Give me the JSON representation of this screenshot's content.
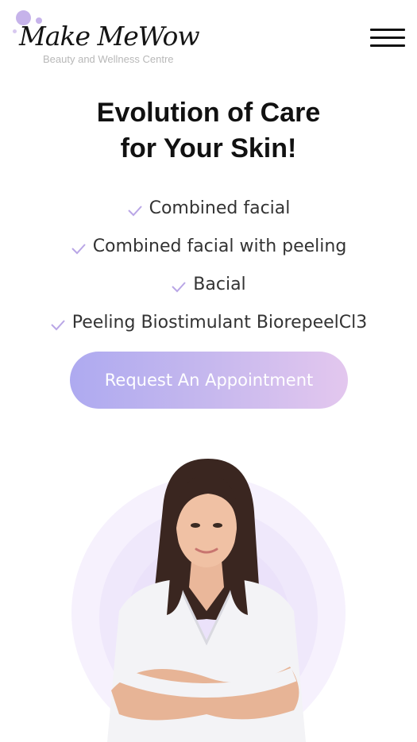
{
  "header": {
    "logo_text": "Make MeWow",
    "logo_tagline": "Beauty and Wellness Centre",
    "menu_icon": "hamburger-menu-icon"
  },
  "hero": {
    "title_line1": "Evolution of Care",
    "title_line2": "for Your Skin!"
  },
  "features": [
    {
      "label": "Combined facial",
      "icon": "check-icon"
    },
    {
      "label": "Combined facial with peeling",
      "icon": "check-icon"
    },
    {
      "label": "Bacial",
      "icon": "check-icon"
    },
    {
      "label": "Peeling Biostimulant BiorepeelCl3",
      "icon": "check-icon"
    }
  ],
  "cta": {
    "label": "Request An Appointment"
  },
  "colors": {
    "accent_start": "#aeaaf0",
    "accent_end": "#e3c7ee",
    "check": "#b9a6e6",
    "halo": "#efe8fb"
  }
}
